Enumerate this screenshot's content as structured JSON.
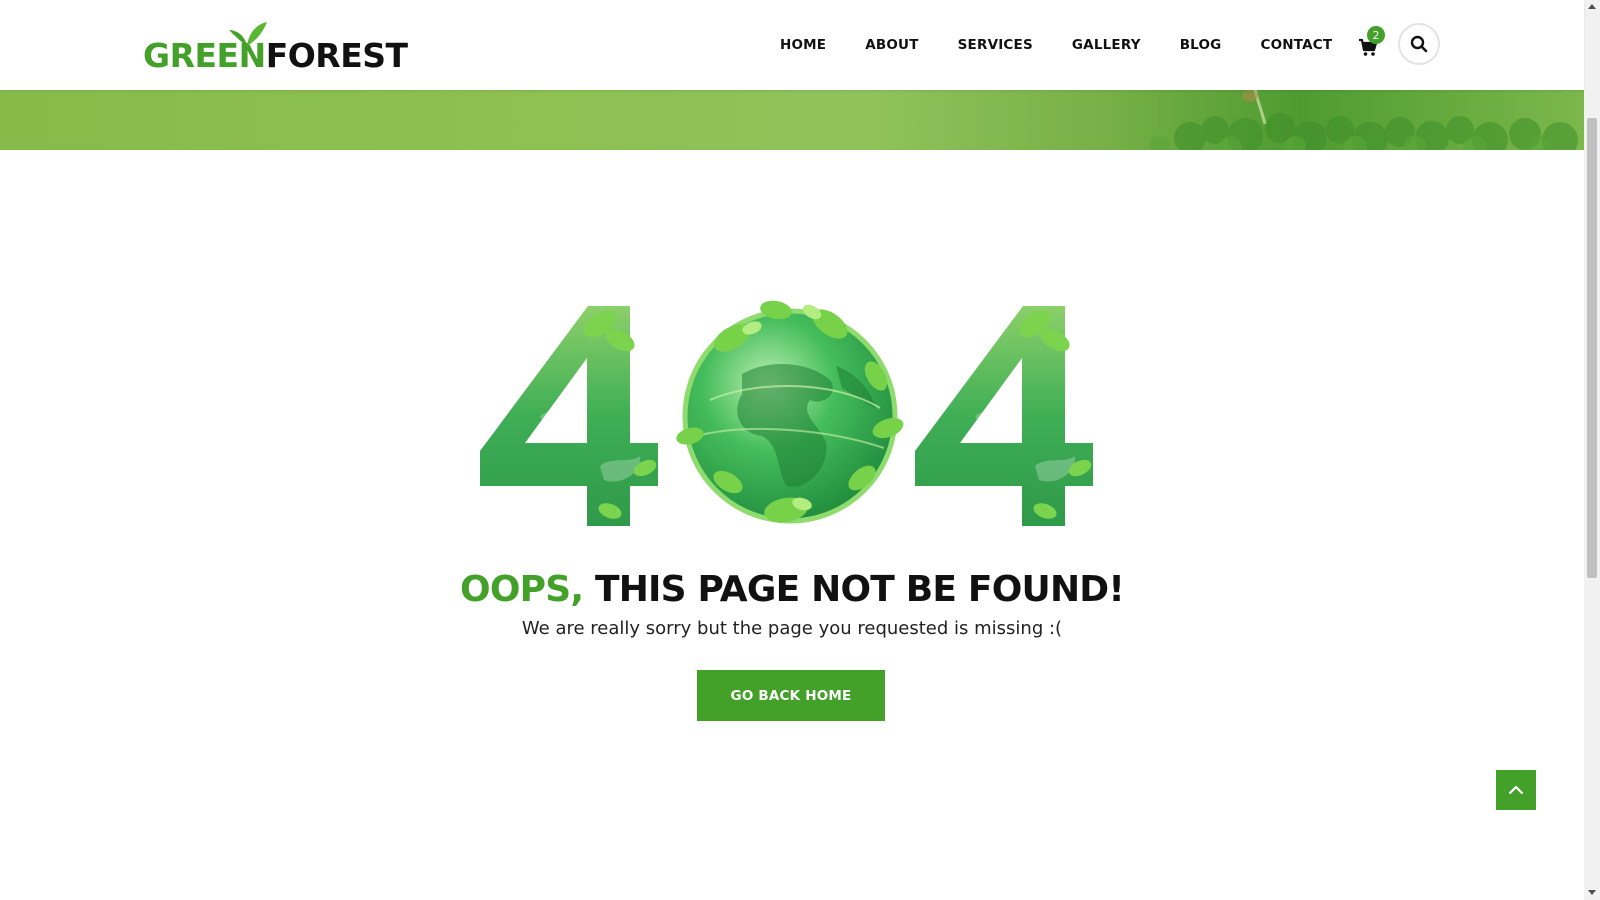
{
  "brand": {
    "logo_part_green": "GREEN",
    "logo_part_dark": "FOREST",
    "green": "#43a12a"
  },
  "nav": {
    "items": [
      {
        "label": "HOME"
      },
      {
        "label": "ABOUT"
      },
      {
        "label": "SERVICES"
      },
      {
        "label": "GALLERY"
      },
      {
        "label": "BLOG"
      },
      {
        "label": "CONTACT"
      }
    ]
  },
  "cart": {
    "count": "2",
    "icon": "shopping-cart-icon"
  },
  "search": {
    "icon": "search-icon"
  },
  "error": {
    "code": "404",
    "headline_green": "OOPS,",
    "headline_dark": " THIS PAGE NOT BE FOUND!",
    "message": "We are really sorry but the page you requested is missing :(",
    "button_label": "GO BACK HOME"
  },
  "back_to_top": {
    "icon": "chevron-up-icon"
  }
}
